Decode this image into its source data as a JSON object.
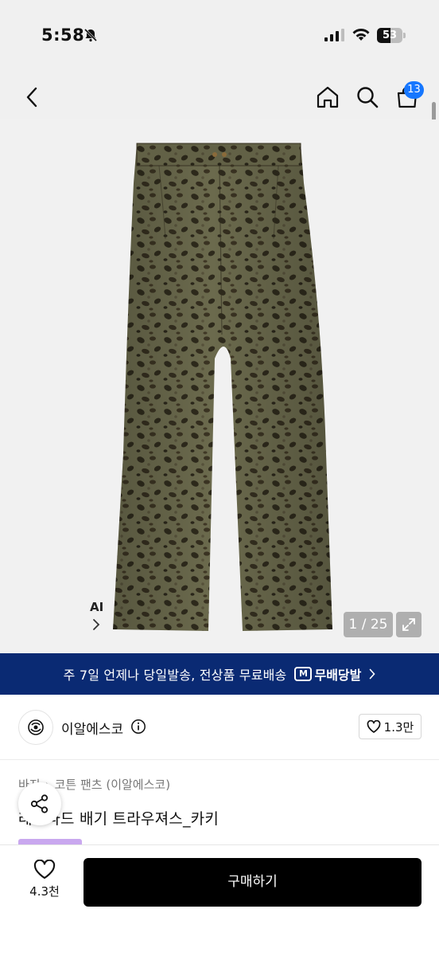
{
  "status_bar": {
    "time": "5:58",
    "battery_level": "53",
    "battery_fraction": 0.53
  },
  "nav": {
    "cart_count": "13"
  },
  "gallery": {
    "ai_label": "AI",
    "page_counter": "1 / 25"
  },
  "promo": {
    "text": "주 7일 언제나 당일발송, 전상품 무료배송",
    "logo_mark": "M",
    "logo_text": "무배당발"
  },
  "brand": {
    "name": "이알에스코",
    "like_count": "1.3만"
  },
  "product": {
    "breadcrumb": [
      "바지",
      "코튼 팬츠 (이알에스코)"
    ],
    "title": "레오파드 배기 트라우져스_카키"
  },
  "bottom_bar": {
    "like_count": "4.3천",
    "buy_label": "구매하기"
  },
  "colors": {
    "promo_bg": "#0a2a73",
    "badge": "#1677ff",
    "buy_button": "#000000",
    "tag": "#c9a8ef"
  }
}
